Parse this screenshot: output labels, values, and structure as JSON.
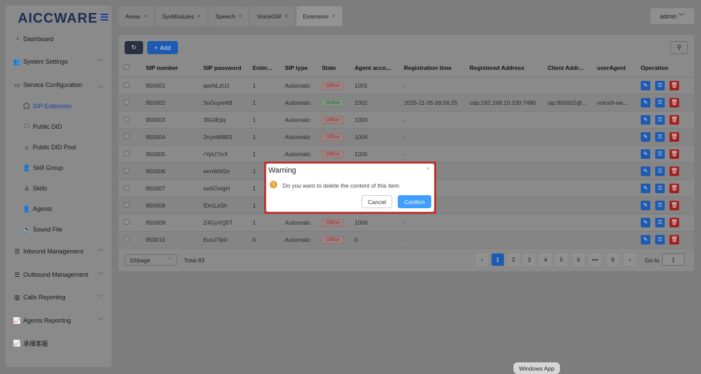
{
  "app": {
    "logo": "AICCWARE"
  },
  "sidebar": {
    "items": [
      {
        "label": "Dashboard",
        "icon": "dashboard-icon"
      },
      {
        "label": "System Settings",
        "icon": "users-icon"
      },
      {
        "label": "Service Configuration",
        "icon": "id-card-icon"
      },
      {
        "label": "SIP Extension",
        "icon": "headset-icon"
      },
      {
        "label": "Public DID",
        "icon": "folder-icon"
      },
      {
        "label": "Public DID Pool",
        "icon": "home-icon"
      },
      {
        "label": "Skill Group",
        "icon": "user-icon"
      },
      {
        "label": "Skills",
        "icon": "user-outline-icon"
      },
      {
        "label": "Agents",
        "icon": "user-icon"
      },
      {
        "label": "Sound File",
        "icon": "sound-icon"
      },
      {
        "label": "Inbound Management",
        "icon": "list-icon"
      },
      {
        "label": "Outbound Management",
        "icon": "list-icon"
      },
      {
        "label": "Calls Reporting",
        "icon": "bar-chart-icon"
      },
      {
        "label": "Agents Reporting",
        "icon": "line-chart-icon"
      },
      {
        "label": "承揮客服",
        "icon": "line-chart-icon"
      }
    ]
  },
  "tabs": [
    {
      "label": "Areas"
    },
    {
      "label": "SysModules"
    },
    {
      "label": "Speech"
    },
    {
      "label": "VoiceGW"
    },
    {
      "label": "Extension"
    }
  ],
  "user": {
    "label": "admin"
  },
  "toolbar": {
    "add_label": "Add"
  },
  "table": {
    "columns": [
      "SIP number",
      "SIP password",
      "Enter...",
      "SIP type",
      "State",
      "Agent acco...",
      "Registration time",
      "Registered Address",
      "Client Addr...",
      "userAgent",
      "Operation"
    ],
    "rows": [
      {
        "sip": "950001",
        "pwd": "qwAiLzUJ",
        "ent": "1",
        "type": "Automatic",
        "state": "Offline",
        "agent": "1001",
        "reg": "-",
        "addr": "",
        "client": "",
        "ua": ""
      },
      {
        "sip": "950002",
        "pwd": "3nGuywAB",
        "ent": "1",
        "type": "Automatic",
        "state": "Online",
        "agent": "1002",
        "reg": "2025-11-05 09:56:25",
        "addr": "udp:192.168.10.230:7480",
        "client": "sip:950002@...",
        "ua": "voice9-we..."
      },
      {
        "sip": "950003",
        "pwd": "3fG4Ejlq",
        "ent": "1",
        "type": "Automatic",
        "state": "Offline",
        "agent": "1003",
        "reg": "-",
        "addr": "",
        "client": "",
        "ua": ""
      },
      {
        "sip": "950004",
        "pwd": "2nyeW8BS",
        "ent": "1",
        "type": "Automatic",
        "state": "Offline",
        "agent": "1004",
        "reg": "-",
        "addr": "",
        "client": "",
        "ua": ""
      },
      {
        "sip": "950005",
        "pwd": "rYpU7rcX",
        "ent": "1",
        "type": "Automatic",
        "state": "Offline",
        "agent": "1005",
        "reg": "-",
        "addr": "",
        "client": "",
        "ua": ""
      },
      {
        "sip": "950006",
        "pwd": "eenWbf2e",
        "ent": "1",
        "type": "",
        "state": "",
        "agent": "",
        "reg": "",
        "addr": "",
        "client": "",
        "ua": ""
      },
      {
        "sip": "950007",
        "pwd": "xw5OxlgH",
        "ent": "1",
        "type": "",
        "state": "",
        "agent": "",
        "reg": "",
        "addr": "",
        "client": "",
        "ua": ""
      },
      {
        "sip": "950008",
        "pwd": "IDrcLsSh",
        "ent": "1",
        "type": "",
        "state": "",
        "agent": "",
        "reg": "",
        "addr": "",
        "client": "",
        "ua": ""
      },
      {
        "sip": "950009",
        "pwd": "Z4GyVQ5T",
        "ent": "1",
        "type": "Automatic",
        "state": "Offline",
        "agent": "1009",
        "reg": "-",
        "addr": "",
        "client": "",
        "ua": ""
      },
      {
        "sip": "950010",
        "pwd": "EuoJ7jk0",
        "ent": "0",
        "type": "Automatic",
        "state": "Offline",
        "agent": "0",
        "reg": "-",
        "addr": "",
        "client": "",
        "ua": ""
      }
    ]
  },
  "pager": {
    "page_size": "10/page",
    "total": "Total 83",
    "pages": [
      "1",
      "2",
      "3",
      "4",
      "5",
      "6",
      "•••",
      "9"
    ],
    "current": "1",
    "goto_label": "Go to",
    "goto_value": "1"
  },
  "dialog": {
    "title": "Warning",
    "message": "Do you want to delete the content of this item",
    "cancel_label": "Cancel",
    "confirm_label": "Confirm"
  },
  "taskbar": {
    "tooltip": "Windows App"
  },
  "colors": {
    "accent": "#409eff",
    "danger": "#e01a1a",
    "warning": "#e6a23c"
  }
}
